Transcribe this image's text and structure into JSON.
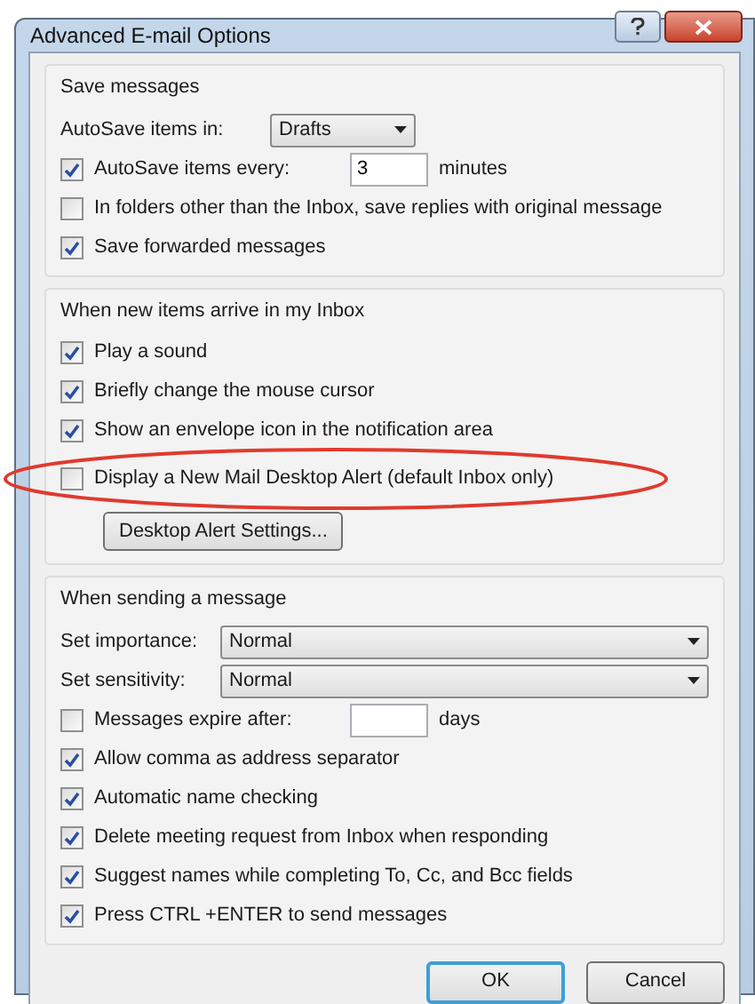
{
  "window": {
    "title": "Advanced E-mail Options"
  },
  "groups": [
    {
      "heading": "Save messages",
      "rows": [
        {
          "kind": "select",
          "label": "AutoSave items in:",
          "value": "Drafts"
        },
        {
          "kind": "checkfield",
          "label": "AutoSave items every:",
          "checked": true,
          "value": "3",
          "suffix": "minutes"
        },
        {
          "kind": "checkbox",
          "label": "In folders other than the Inbox, save replies with original message",
          "checked": false
        },
        {
          "kind": "checkbox",
          "label": "Save forwarded messages",
          "checked": true
        }
      ]
    },
    {
      "heading": "When new items arrive in my Inbox",
      "rows": [
        {
          "kind": "checkbox",
          "label": "Play a sound",
          "checked": true
        },
        {
          "kind": "checkbox",
          "label": "Briefly change the mouse cursor",
          "checked": true
        },
        {
          "kind": "checkbox",
          "label": "Show an envelope icon in the notification area",
          "checked": true
        },
        {
          "kind": "checkbox",
          "label": "Display a New Mail Desktop Alert (default Inbox only)",
          "checked": false,
          "highlighted": true
        },
        {
          "kind": "button",
          "label": "Desktop Alert Settings..."
        }
      ]
    },
    {
      "heading": "When sending a message",
      "rows": [
        {
          "kind": "wideselect",
          "label": "Set importance:",
          "value": "Normal"
        },
        {
          "kind": "wideselect",
          "label": "Set sensitivity:",
          "value": "Normal"
        },
        {
          "kind": "checkfield",
          "label": "Messages expire after:",
          "checked": false,
          "suffix": "days"
        },
        {
          "kind": "checkbox",
          "label": "Allow comma as address separator",
          "checked": true
        },
        {
          "kind": "checkbox",
          "label": "Automatic name checking",
          "checked": true
        },
        {
          "kind": "checkbox",
          "label": "Delete meeting request from Inbox when responding",
          "checked": true
        },
        {
          "kind": "checkbox",
          "label": "Suggest names while completing To, Cc, and Bcc fields",
          "checked": true
        },
        {
          "kind": "checkbox",
          "label": "Press CTRL +ENTER to send messages",
          "checked": true
        }
      ]
    }
  ],
  "buttons": [
    {
      "label": "OK",
      "default": true
    },
    {
      "label": "Cancel",
      "default": false
    }
  ]
}
